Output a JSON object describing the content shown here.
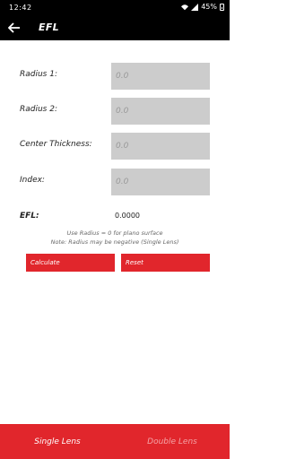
{
  "status_bar": {
    "time": "12:42",
    "battery_level": "45%",
    "icons": [
      "wifi-icon",
      "signal-icon",
      "battery-icon"
    ]
  },
  "app_bar": {
    "title": "EFL",
    "back_icon": "arrow-left-icon"
  },
  "form": {
    "fields": [
      {
        "label": "Radius 1:",
        "placeholder": "0.0"
      },
      {
        "label": "Radius 2:",
        "placeholder": "0.0"
      },
      {
        "label": "Center Thickness:",
        "placeholder": "0.0"
      },
      {
        "label": "Index:",
        "placeholder": "0.0"
      }
    ],
    "efl_label": "EFL:",
    "efl_value": "0.0000"
  },
  "notes": {
    "line1": "Use Radius = 0 for plano surface",
    "line2": "Note: Radius may be negative  (Single Lens)"
  },
  "buttons": {
    "calculate": "Calculate",
    "reset": "Reset"
  },
  "bottom_nav": {
    "tabs": [
      {
        "label": "Single Lens",
        "active": true
      },
      {
        "label": "Double Lens",
        "active": false
      }
    ]
  },
  "colors": {
    "accent": "#e1262c",
    "app_bar": "#000000",
    "input_bg": "#cccccc"
  }
}
